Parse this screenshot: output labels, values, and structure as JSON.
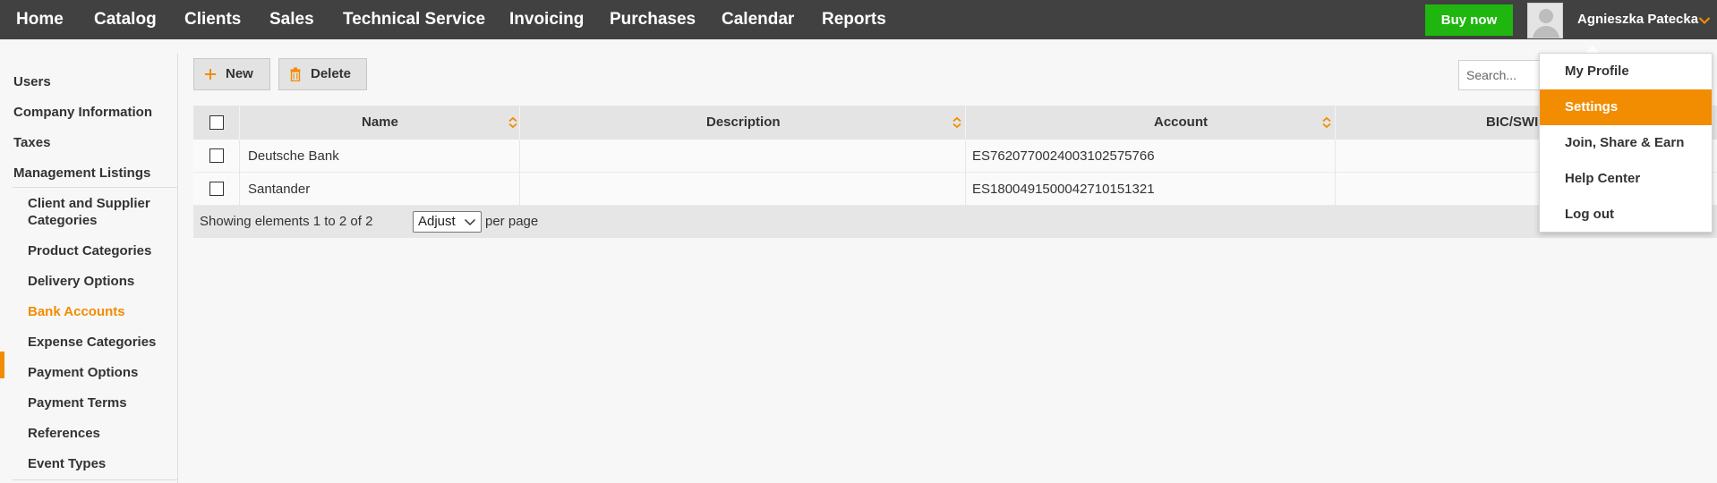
{
  "nav": {
    "items": [
      "Home",
      "Catalog",
      "Clients",
      "Sales",
      "Technical Service",
      "Invoicing",
      "Purchases",
      "Calendar",
      "Reports"
    ],
    "buy_label": "Buy now",
    "user_name": "Agnieszka Patecka"
  },
  "sidebar": {
    "items": [
      "Users",
      "Company Information",
      "Taxes",
      "Management Listings"
    ],
    "sub_items": [
      "Client and Supplier Categories",
      "Product Categories",
      "Delivery Options",
      "Bank Accounts",
      "Expense Categories",
      "Payment Options",
      "Payment Terms",
      "References",
      "Event Types"
    ],
    "active_sub": "Bank Accounts"
  },
  "toolbar": {
    "new_label": "New",
    "delete_label": "Delete",
    "search_placeholder": "Search..."
  },
  "table": {
    "columns": [
      "Name",
      "Description",
      "Account",
      "BIC/SWI"
    ],
    "rows": [
      {
        "name": "Deutsche Bank",
        "description": "",
        "account": "ES7620770024003102575766",
        "bic": ""
      },
      {
        "name": "Santander",
        "description": "",
        "account": "ES1800491500042710151321",
        "bic": ""
      }
    ],
    "footer": {
      "showing": "Showing elements 1 to 2 of 2",
      "per_page_value": "Adjust",
      "per_page_label": "per page"
    }
  },
  "user_menu": {
    "items": [
      "My Profile",
      "Settings",
      "Join, Share & Earn",
      "Help Center",
      "Log out"
    ],
    "active": "Settings"
  },
  "colors": {
    "accent": "#f28c00",
    "nav_bg": "#414141",
    "buy_green": "#1fb60f"
  }
}
